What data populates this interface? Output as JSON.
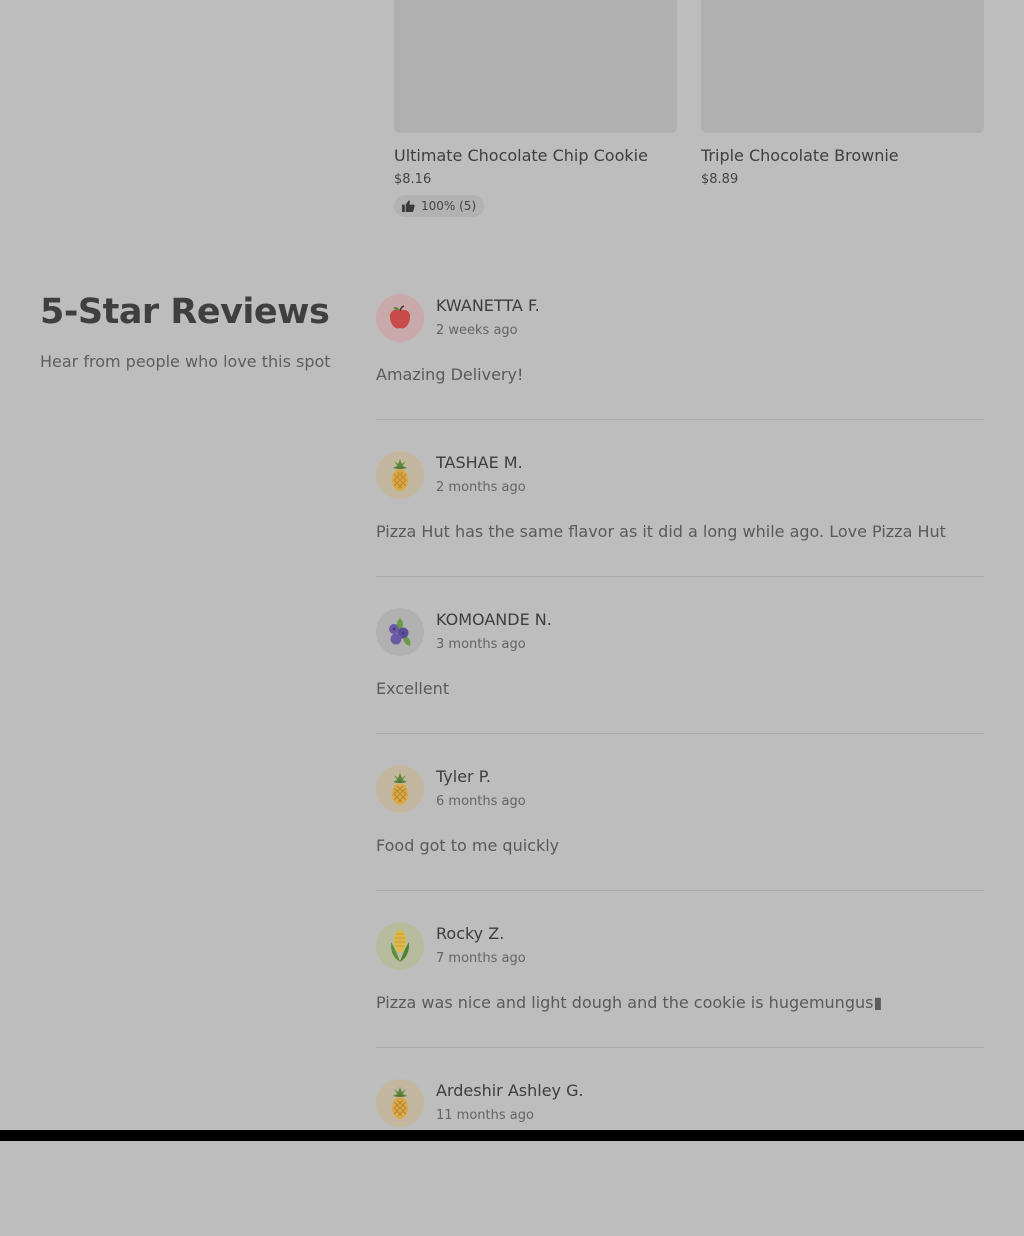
{
  "products": [
    {
      "name": "Ultimate Chocolate Chip Cookie",
      "price": "$8.16",
      "rating": "100% (5)"
    },
    {
      "name": "Triple Chocolate Brownie",
      "price": "$8.89"
    }
  ],
  "section": {
    "title": "5-Star Reviews",
    "subtitle": "Hear from people who love this spot"
  },
  "reviews": [
    {
      "name": "KWANETTA F.",
      "date": "2 weeks ago",
      "text": "Amazing Delivery!",
      "avatar": "apple-icon"
    },
    {
      "name": "TASHAE M.",
      "date": "2 months ago",
      "text": "Pizza Hut has the same flavor as it did a long while ago. Love Pizza Hut",
      "avatar": "pineapple-icon"
    },
    {
      "name": "KOMOANDE N.",
      "date": "3 months ago",
      "text": "Excellent",
      "avatar": "blueberry-icon"
    },
    {
      "name": "Tyler P.",
      "date": "6 months ago",
      "text": "Food got to me quickly",
      "avatar": "pineapple-icon"
    },
    {
      "name": "Rocky Z.",
      "date": "7 months ago",
      "text": "Pizza was nice and light dough and the cookie is hugemungus▮",
      "avatar": "corn-icon"
    },
    {
      "name": "Ardeshir Ashley G.",
      "date": "11 months ago",
      "text": "",
      "avatar": "pineapple-icon"
    }
  ],
  "colors": {
    "page_background": "#bdbdbd",
    "product_image_placeholder": "#b0b0b0",
    "avatar_apple_bg": "#c9a9a9",
    "avatar_pineapple_bg": "#c4b79f",
    "avatar_blueberry_bg": "#b1b1b1",
    "avatar_corn_bg": "#b7bc9f"
  }
}
